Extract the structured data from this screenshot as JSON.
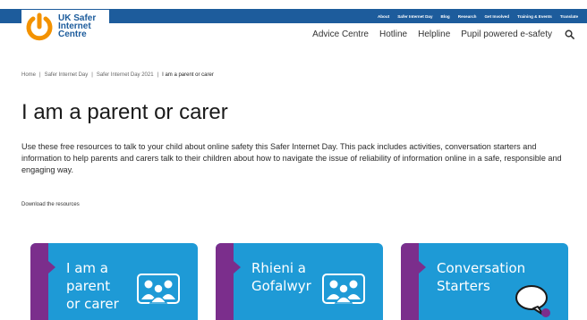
{
  "topbar": {
    "links": [
      "About",
      "Safer Internet Day",
      "Blog",
      "Research",
      "Get Involved",
      "Training & Events",
      "Translate"
    ]
  },
  "logo": {
    "line1": "UK Safer",
    "line2": "Internet",
    "line3": "Centre",
    "colors": {
      "orange": "#f39200",
      "blue": "#1d5c9c"
    }
  },
  "nav": {
    "items": [
      "Advice Centre",
      "Hotline",
      "Helpline",
      "Pupil powered e-safety"
    ]
  },
  "breadcrumb": {
    "items": [
      "Home",
      "Safer Internet Day",
      "Safer Internet Day 2021"
    ],
    "current": "I am a parent or carer"
  },
  "page": {
    "title": "I am a parent or carer",
    "intro": "Use these free resources to talk to your child about online safety this Safer Internet Day. This pack includes activities, conversation starters and information to help parents and carers talk to their children about how to navigate the issue of reliability of information online in a safe, responsible and engaging way.",
    "download_label": "Download the resources"
  },
  "cards": [
    {
      "label": "I am a\nparent\nor carer",
      "icon": "people-group-icon"
    },
    {
      "label": "Rhieni a\nGofalwyr",
      "icon": "people-group-icon"
    },
    {
      "label": "Conversation\nStarters",
      "icon": "speech-bubble-icon"
    }
  ],
  "colors": {
    "topbar": "#1d5c9c",
    "card_blue": "#1e9ad6",
    "card_purple": "#7b2e8c"
  }
}
